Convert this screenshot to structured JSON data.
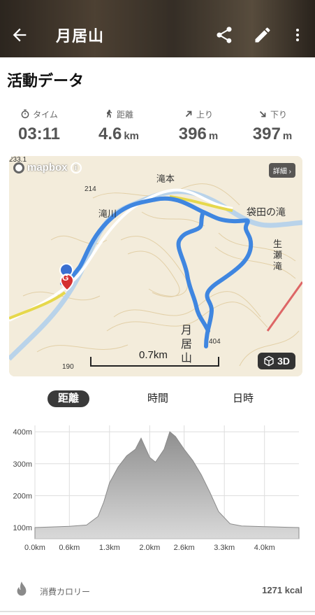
{
  "header": {
    "title": "月居山"
  },
  "section_title": "活動データ",
  "stats": [
    {
      "label": "タイム",
      "value": "03:11",
      "unit": ""
    },
    {
      "label": "距離",
      "value": "4.6",
      "unit": "km"
    },
    {
      "label": "上り",
      "value": "396",
      "unit": "m"
    },
    {
      "label": "下り",
      "value": "397",
      "unit": "m"
    }
  ],
  "map": {
    "brand": "mapbox",
    "detail_label": "詳細",
    "btn3d_label": "3D",
    "scale_label": "0.7km",
    "labels": {
      "takimoto": "滝本",
      "takigawa": "滝川",
      "fukuroda": "袋田の滝",
      "ikuse": "生瀬滝",
      "tsukioresan": "月居山",
      "elev214": "214",
      "elev233": "233.1",
      "elev404": "404",
      "elev190": "190"
    },
    "goal_marker": "G"
  },
  "tabs": [
    "距離",
    "時間",
    "日時"
  ],
  "chart_data": {
    "type": "area",
    "title": "",
    "xlabel": "",
    "ylabel": "",
    "x_ticks": [
      "0.0km",
      "0.6km",
      "1.3km",
      "2.0km",
      "2.6km",
      "3.3km",
      "4.0km"
    ],
    "y_ticks": [
      "100m",
      "200m",
      "300m",
      "400m"
    ],
    "xlim": [
      0,
      4.6
    ],
    "ylim": [
      65,
      420
    ],
    "x": [
      0.0,
      0.3,
      0.6,
      0.9,
      1.1,
      1.2,
      1.3,
      1.45,
      1.6,
      1.75,
      1.85,
      2.0,
      2.1,
      2.25,
      2.35,
      2.45,
      2.6,
      2.75,
      2.9,
      3.05,
      3.2,
      3.4,
      3.6,
      3.8,
      4.0,
      4.2,
      4.4,
      4.6
    ],
    "values": [
      100,
      102,
      104,
      108,
      135,
      180,
      240,
      290,
      325,
      345,
      380,
      320,
      305,
      345,
      400,
      385,
      345,
      310,
      265,
      210,
      150,
      112,
      105,
      104,
      103,
      102,
      101,
      100
    ]
  },
  "calorie": {
    "label": "消費カロリー",
    "value": "1271 kcal"
  },
  "colors": {
    "route": "#3f86e0",
    "area_fill": "#9e9e9e",
    "grid": "#dddddd"
  }
}
